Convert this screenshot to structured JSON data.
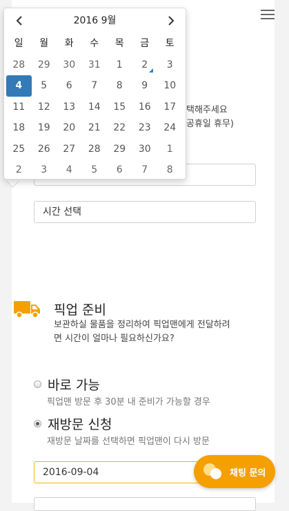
{
  "header": {
    "menu_icon": "hamburger-menu-icon"
  },
  "partial_texts": {
    "line1": "택해주세요",
    "line2": "공휴일 휴무)"
  },
  "pickup_date_input": {
    "value": ""
  },
  "time_select": {
    "placeholder": "시간 선택"
  },
  "pickup_prep": {
    "title": "픽업 준비",
    "desc_line1": "보관하실 물품을 정리하여 픽업맨에게 전달하려",
    "desc_line2": "면 시간이 얼마나 필요하신가요?",
    "icon": "truck-icon"
  },
  "options": [
    {
      "label": "바로 가능",
      "desc": "픽업맨 방문 후 30분 내 준비가 가능할 경우",
      "checked": false
    },
    {
      "label": "재방문 신청",
      "desc": "재방문 날짜를 선택하면 픽업맨이 다시 방문",
      "checked": true
    }
  ],
  "revisit_date_input": {
    "value": "2016-09-04"
  },
  "calendar": {
    "title": "2016 9월",
    "prev": "‹",
    "next": "›",
    "weekdays": [
      "일",
      "월",
      "화",
      "수",
      "목",
      "금",
      "토"
    ],
    "weeks": [
      [
        "28",
        "29",
        "30",
        "31",
        "1",
        "2",
        "3"
      ],
      [
        "4",
        "5",
        "6",
        "7",
        "8",
        "9",
        "10"
      ],
      [
        "11",
        "12",
        "13",
        "14",
        "15",
        "16",
        "17"
      ],
      [
        "18",
        "19",
        "20",
        "21",
        "22",
        "23",
        "24"
      ],
      [
        "25",
        "26",
        "27",
        "28",
        "29",
        "30",
        "1"
      ],
      [
        "2",
        "3",
        "4",
        "5",
        "6",
        "7",
        "8"
      ]
    ],
    "selected": "4",
    "colors": {
      "selected_bg": "#337ab7",
      "today_marker": "#2a7fd4"
    }
  },
  "chat_button": {
    "label": "채팅 문의",
    "color": "#f5a000"
  }
}
